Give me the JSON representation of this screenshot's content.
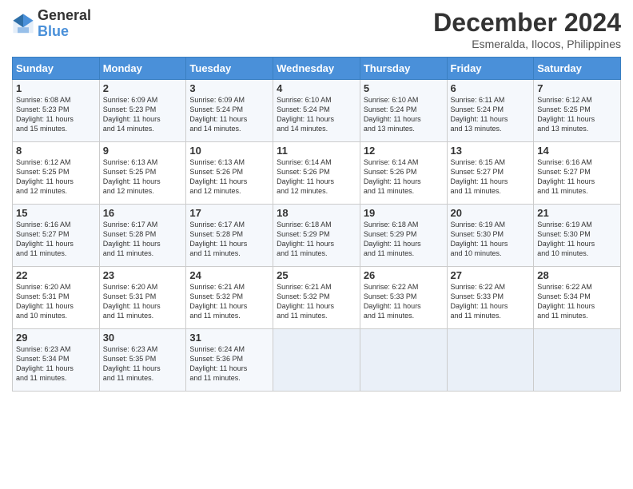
{
  "logo": {
    "general": "General",
    "blue": "Blue"
  },
  "title": "December 2024",
  "subtitle": "Esmeralda, Ilocos, Philippines",
  "days_of_week": [
    "Sunday",
    "Monday",
    "Tuesday",
    "Wednesday",
    "Thursday",
    "Friday",
    "Saturday"
  ],
  "weeks": [
    [
      {
        "day": "1",
        "lines": [
          "Sunrise: 6:08 AM",
          "Sunset: 5:23 PM",
          "Daylight: 11 hours",
          "and 15 minutes."
        ]
      },
      {
        "day": "2",
        "lines": [
          "Sunrise: 6:09 AM",
          "Sunset: 5:23 PM",
          "Daylight: 11 hours",
          "and 14 minutes."
        ]
      },
      {
        "day": "3",
        "lines": [
          "Sunrise: 6:09 AM",
          "Sunset: 5:24 PM",
          "Daylight: 11 hours",
          "and 14 minutes."
        ]
      },
      {
        "day": "4",
        "lines": [
          "Sunrise: 6:10 AM",
          "Sunset: 5:24 PM",
          "Daylight: 11 hours",
          "and 14 minutes."
        ]
      },
      {
        "day": "5",
        "lines": [
          "Sunrise: 6:10 AM",
          "Sunset: 5:24 PM",
          "Daylight: 11 hours",
          "and 13 minutes."
        ]
      },
      {
        "day": "6",
        "lines": [
          "Sunrise: 6:11 AM",
          "Sunset: 5:24 PM",
          "Daylight: 11 hours",
          "and 13 minutes."
        ]
      },
      {
        "day": "7",
        "lines": [
          "Sunrise: 6:12 AM",
          "Sunset: 5:25 PM",
          "Daylight: 11 hours",
          "and 13 minutes."
        ]
      }
    ],
    [
      {
        "day": "8",
        "lines": [
          "Sunrise: 6:12 AM",
          "Sunset: 5:25 PM",
          "Daylight: 11 hours",
          "and 12 minutes."
        ]
      },
      {
        "day": "9",
        "lines": [
          "Sunrise: 6:13 AM",
          "Sunset: 5:25 PM",
          "Daylight: 11 hours",
          "and 12 minutes."
        ]
      },
      {
        "day": "10",
        "lines": [
          "Sunrise: 6:13 AM",
          "Sunset: 5:26 PM",
          "Daylight: 11 hours",
          "and 12 minutes."
        ]
      },
      {
        "day": "11",
        "lines": [
          "Sunrise: 6:14 AM",
          "Sunset: 5:26 PM",
          "Daylight: 11 hours",
          "and 12 minutes."
        ]
      },
      {
        "day": "12",
        "lines": [
          "Sunrise: 6:14 AM",
          "Sunset: 5:26 PM",
          "Daylight: 11 hours",
          "and 11 minutes."
        ]
      },
      {
        "day": "13",
        "lines": [
          "Sunrise: 6:15 AM",
          "Sunset: 5:27 PM",
          "Daylight: 11 hours",
          "and 11 minutes."
        ]
      },
      {
        "day": "14",
        "lines": [
          "Sunrise: 6:16 AM",
          "Sunset: 5:27 PM",
          "Daylight: 11 hours",
          "and 11 minutes."
        ]
      }
    ],
    [
      {
        "day": "15",
        "lines": [
          "Sunrise: 6:16 AM",
          "Sunset: 5:27 PM",
          "Daylight: 11 hours",
          "and 11 minutes."
        ]
      },
      {
        "day": "16",
        "lines": [
          "Sunrise: 6:17 AM",
          "Sunset: 5:28 PM",
          "Daylight: 11 hours",
          "and 11 minutes."
        ]
      },
      {
        "day": "17",
        "lines": [
          "Sunrise: 6:17 AM",
          "Sunset: 5:28 PM",
          "Daylight: 11 hours",
          "and 11 minutes."
        ]
      },
      {
        "day": "18",
        "lines": [
          "Sunrise: 6:18 AM",
          "Sunset: 5:29 PM",
          "Daylight: 11 hours",
          "and 11 minutes."
        ]
      },
      {
        "day": "19",
        "lines": [
          "Sunrise: 6:18 AM",
          "Sunset: 5:29 PM",
          "Daylight: 11 hours",
          "and 11 minutes."
        ]
      },
      {
        "day": "20",
        "lines": [
          "Sunrise: 6:19 AM",
          "Sunset: 5:30 PM",
          "Daylight: 11 hours",
          "and 10 minutes."
        ]
      },
      {
        "day": "21",
        "lines": [
          "Sunrise: 6:19 AM",
          "Sunset: 5:30 PM",
          "Daylight: 11 hours",
          "and 10 minutes."
        ]
      }
    ],
    [
      {
        "day": "22",
        "lines": [
          "Sunrise: 6:20 AM",
          "Sunset: 5:31 PM",
          "Daylight: 11 hours",
          "and 10 minutes."
        ]
      },
      {
        "day": "23",
        "lines": [
          "Sunrise: 6:20 AM",
          "Sunset: 5:31 PM",
          "Daylight: 11 hours",
          "and 11 minutes."
        ]
      },
      {
        "day": "24",
        "lines": [
          "Sunrise: 6:21 AM",
          "Sunset: 5:32 PM",
          "Daylight: 11 hours",
          "and 11 minutes."
        ]
      },
      {
        "day": "25",
        "lines": [
          "Sunrise: 6:21 AM",
          "Sunset: 5:32 PM",
          "Daylight: 11 hours",
          "and 11 minutes."
        ]
      },
      {
        "day": "26",
        "lines": [
          "Sunrise: 6:22 AM",
          "Sunset: 5:33 PM",
          "Daylight: 11 hours",
          "and 11 minutes."
        ]
      },
      {
        "day": "27",
        "lines": [
          "Sunrise: 6:22 AM",
          "Sunset: 5:33 PM",
          "Daylight: 11 hours",
          "and 11 minutes."
        ]
      },
      {
        "day": "28",
        "lines": [
          "Sunrise: 6:22 AM",
          "Sunset: 5:34 PM",
          "Daylight: 11 hours",
          "and 11 minutes."
        ]
      }
    ],
    [
      {
        "day": "29",
        "lines": [
          "Sunrise: 6:23 AM",
          "Sunset: 5:34 PM",
          "Daylight: 11 hours",
          "and 11 minutes."
        ]
      },
      {
        "day": "30",
        "lines": [
          "Sunrise: 6:23 AM",
          "Sunset: 5:35 PM",
          "Daylight: 11 hours",
          "and 11 minutes."
        ]
      },
      {
        "day": "31",
        "lines": [
          "Sunrise: 6:24 AM",
          "Sunset: 5:36 PM",
          "Daylight: 11 hours",
          "and 11 minutes."
        ]
      },
      null,
      null,
      null,
      null
    ]
  ]
}
